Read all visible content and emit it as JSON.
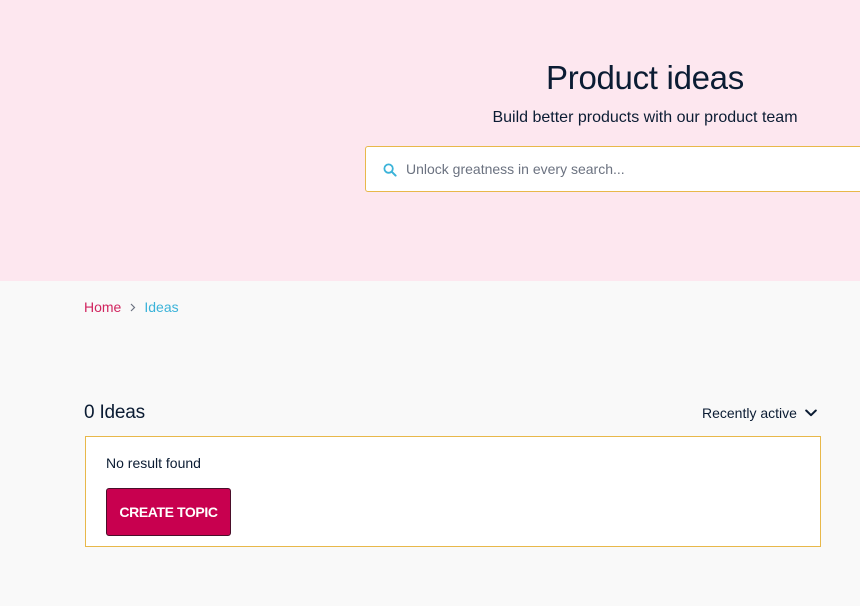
{
  "hero": {
    "title": "Product ideas",
    "subtitle": "Build better products with our product team",
    "background_color": "#fde7ef"
  },
  "search": {
    "placeholder": "Unlock greatness in every search...",
    "value": "",
    "icon": "search-icon",
    "border_color": "#e8b84a"
  },
  "breadcrumb": {
    "items": [
      {
        "label": "Home",
        "color": "#d1255f"
      },
      {
        "label": "Ideas",
        "color": "#3bb3d9"
      }
    ],
    "separator_icon": "chevron-right-icon"
  },
  "ideas": {
    "count_label": "0 Ideas",
    "sort_label": "Recently active",
    "sort_icon": "chevron-down-icon",
    "empty_message": "No result found",
    "create_button_label": "CREATE TOPIC",
    "accent_color": "#c8004f"
  }
}
